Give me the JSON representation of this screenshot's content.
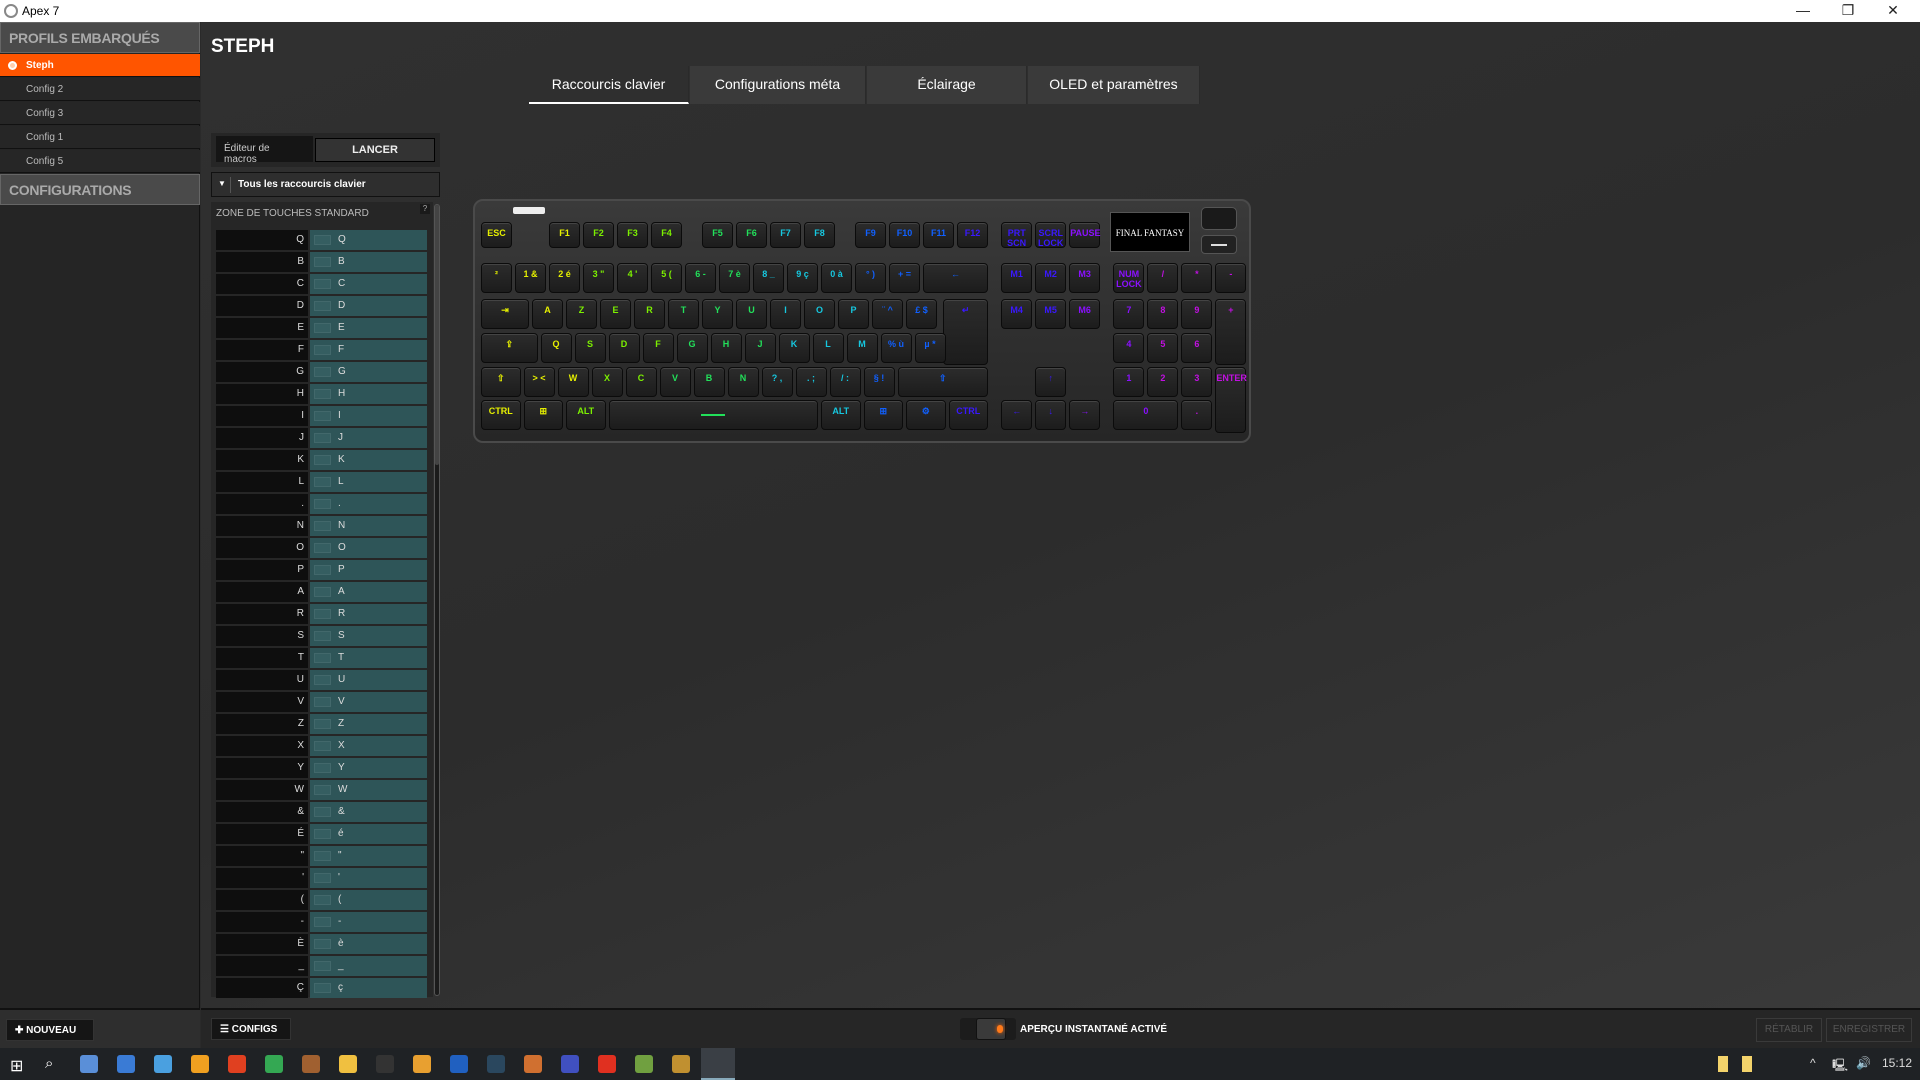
{
  "window": {
    "title": "Apex 7",
    "minimize": "—",
    "restore": "❐",
    "close": "✕"
  },
  "sidebar": {
    "header": "PROFILS EMBARQUÉS",
    "profiles": [
      "Steph",
      "Config 2",
      "Config 3",
      "Config 1",
      "Config 5"
    ],
    "configurations": "CONFIGURATIONS",
    "new_button": "NOUVEAU"
  },
  "main": {
    "title": "STEPH",
    "tabs": [
      "Raccourcis clavier",
      "Configurations méta",
      "Éclairage",
      "OLED et paramètres"
    ],
    "active_tab": 0
  },
  "macro": {
    "label": "Éditeur de macros",
    "button": "LANCER"
  },
  "filter": {
    "selected": "Tous les raccourcis clavier"
  },
  "zone": {
    "title": "ZONE DE TOUCHES STANDARD",
    "help": "?",
    "rows": [
      [
        "Q",
        "Q"
      ],
      [
        "B",
        "B"
      ],
      [
        "C",
        "C"
      ],
      [
        "D",
        "D"
      ],
      [
        "E",
        "E"
      ],
      [
        "F",
        "F"
      ],
      [
        "G",
        "G"
      ],
      [
        "H",
        "H"
      ],
      [
        "I",
        "I"
      ],
      [
        "J",
        "J"
      ],
      [
        "K",
        "K"
      ],
      [
        "L",
        "L"
      ],
      [
        ".",
        "."
      ],
      [
        "N",
        "N"
      ],
      [
        "O",
        "O"
      ],
      [
        "P",
        "P"
      ],
      [
        "A",
        "A"
      ],
      [
        "R",
        "R"
      ],
      [
        "S",
        "S"
      ],
      [
        "T",
        "T"
      ],
      [
        "U",
        "U"
      ],
      [
        "V",
        "V"
      ],
      [
        "Z",
        "Z"
      ],
      [
        "X",
        "X"
      ],
      [
        "Y",
        "Y"
      ],
      [
        "W",
        "W"
      ],
      [
        "&",
        "&"
      ],
      [
        "É",
        "é"
      ],
      [
        "\"",
        "\""
      ],
      [
        "'",
        "'"
      ],
      [
        "(",
        "("
      ],
      [
        "-",
        "-"
      ],
      [
        "È",
        "è"
      ],
      [
        "_",
        "_"
      ],
      [
        "Ç",
        "ç"
      ]
    ]
  },
  "keyboard": {
    "oled_text": "FINAL FANTASY",
    "rows": [
      [
        "ESC",
        "F1",
        "F2",
        "F3",
        "F4",
        "F5",
        "F6",
        "F7",
        "F8",
        "F9",
        "F10",
        "F11",
        "F12",
        "PRT SCN",
        "SCRL LOCK",
        "PAUSE"
      ],
      [
        "²",
        "1 &",
        "2 é",
        "3 \"",
        "4 '",
        "5 (",
        "6 -",
        "7 è",
        "8 _",
        "9 ç",
        "0 à",
        "° )",
        "+ =",
        "←",
        "M1",
        "M2",
        "M3",
        "NUM LOCK",
        "/",
        "*",
        "-"
      ],
      [
        "⇥",
        "A",
        "Z",
        "E",
        "R",
        "T",
        "Y",
        "U",
        "I",
        "O",
        "P",
        "¨ ^",
        "£ $",
        "↵",
        "M4",
        "M5",
        "M6",
        "7",
        "8",
        "9",
        "+"
      ],
      [
        "⇪",
        "Q",
        "S",
        "D",
        "F",
        "G",
        "H",
        "J",
        "K",
        "L",
        "M",
        "% ù",
        "µ *",
        "4",
        "5",
        "6"
      ],
      [
        "⇧",
        "> <",
        "W",
        "X",
        "C",
        "V",
        "B",
        "N",
        "? ,",
        ". ;",
        "/ :",
        "§ !",
        "⇧",
        "↑",
        "1",
        "2",
        "3",
        "ENTER"
      ],
      [
        "CTRL",
        "⊞",
        "ALT",
        "",
        "ALT",
        "⊞",
        "⚙",
        "CTRL",
        "←",
        "↓",
        "→",
        "0",
        "."
      ]
    ],
    "colors": [
      "#e6f000",
      "#7cf000",
      "#22e05a",
      "#16c8e0",
      "#1060ff",
      "#3a18ff",
      "#8a10ff",
      "#c010e0"
    ]
  },
  "bottom": {
    "configs_button": "CONFIGS",
    "preview": "APERÇU INSTANTANÉ ACTIVÉ",
    "preview_on": true,
    "restore": "RÉTABLIR",
    "save": "ENREGISTRER"
  },
  "taskbar": {
    "time": "15:12",
    "tray_up": "^"
  }
}
